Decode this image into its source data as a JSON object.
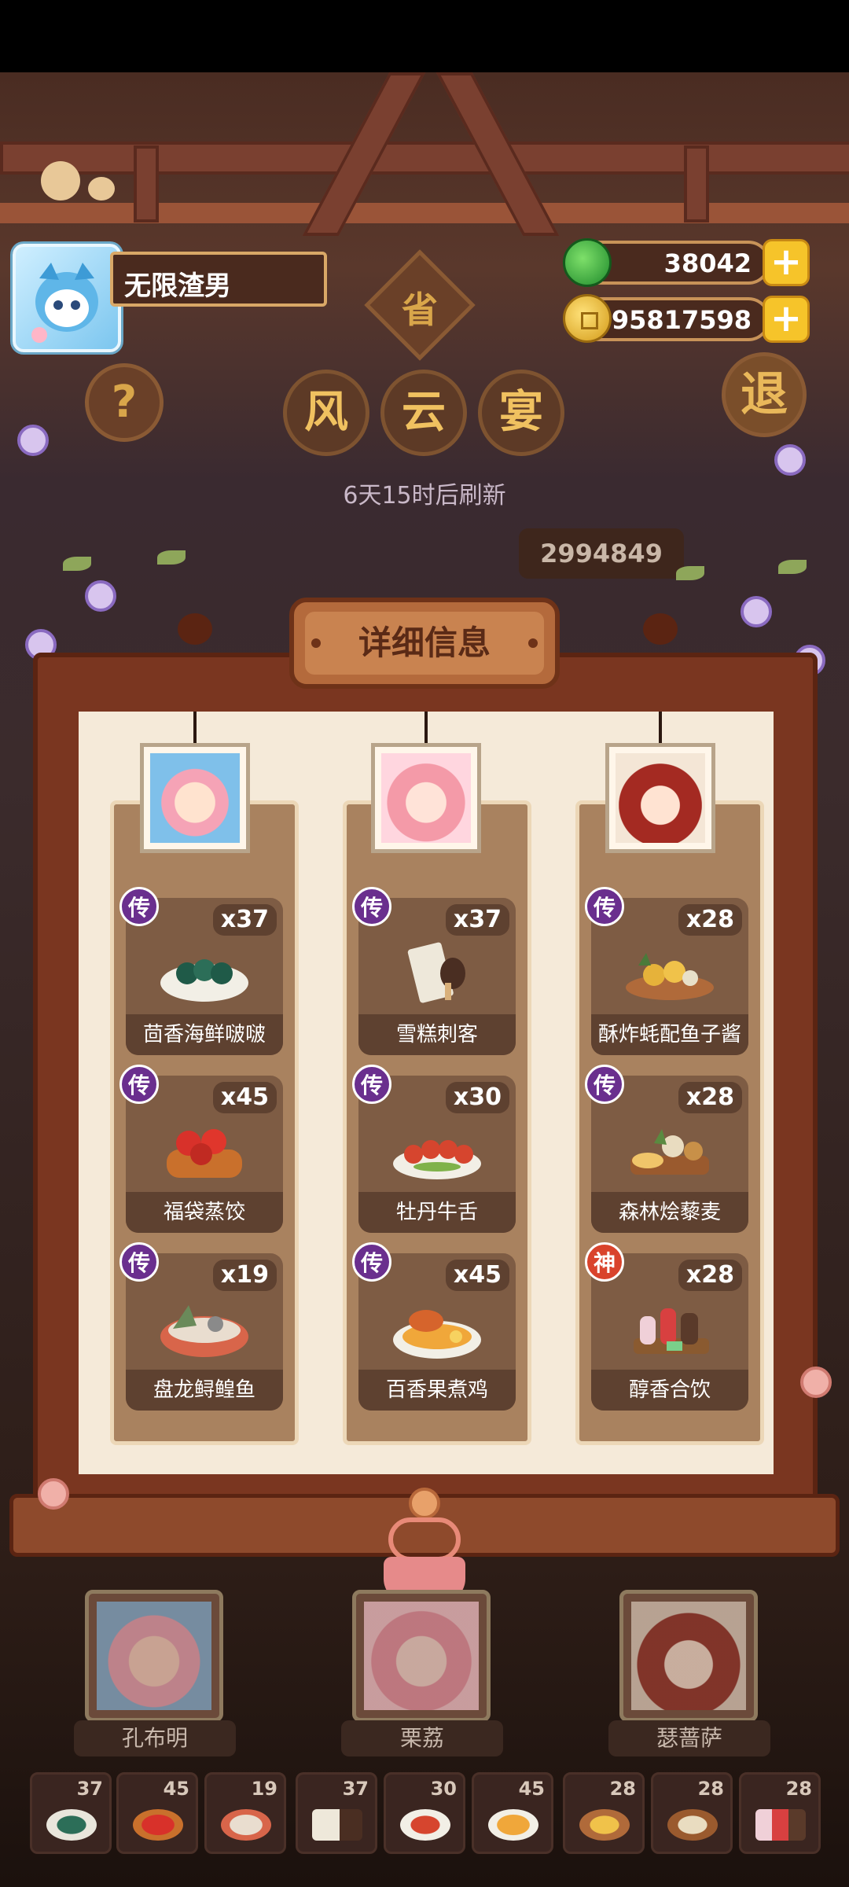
{
  "player": {
    "name": "无限渣男"
  },
  "currency": {
    "jade": "38042",
    "coins": "95817598"
  },
  "header": {
    "province_char": "省",
    "event_chars": [
      "风",
      "云",
      "宴"
    ],
    "help_symbol": "?",
    "exit_char": "退",
    "refresh_text": "6天15时后刷新",
    "score": "2994849"
  },
  "detail_title": "详细信息",
  "columns": [
    {
      "dishes": [
        {
          "name": "茴香海鲜啵啵",
          "qty": "x37",
          "rarity": "传"
        },
        {
          "name": "福袋蒸饺",
          "qty": "x45",
          "rarity": "传"
        },
        {
          "name": "盘龙鲟鳇鱼",
          "qty": "x19",
          "rarity": "传"
        }
      ]
    },
    {
      "dishes": [
        {
          "name": "雪糕刺客",
          "qty": "x37",
          "rarity": "传"
        },
        {
          "name": "牡丹牛舌",
          "qty": "x30",
          "rarity": "传"
        },
        {
          "name": "百香果煮鸡",
          "qty": "x45",
          "rarity": "传"
        }
      ]
    },
    {
      "dishes": [
        {
          "name": "酥炸蚝配鱼子酱",
          "qty": "x28",
          "rarity": "传"
        },
        {
          "name": "森林烩藜麦",
          "qty": "x28",
          "rarity": "传"
        },
        {
          "name": "醇香合饮",
          "qty": "x28",
          "rarity": "神"
        }
      ]
    }
  ],
  "chefs": [
    "孔布明",
    "栗荔",
    "瑟蔷萨"
  ],
  "slots": [
    "37",
    "45",
    "19",
    "37",
    "30",
    "45",
    "28",
    "28",
    "28"
  ],
  "colors": {
    "legend_badge": "#6a2f8e",
    "god_badge": "#d9432c",
    "frame": "#7a3620",
    "panel": "#f5ead9"
  }
}
